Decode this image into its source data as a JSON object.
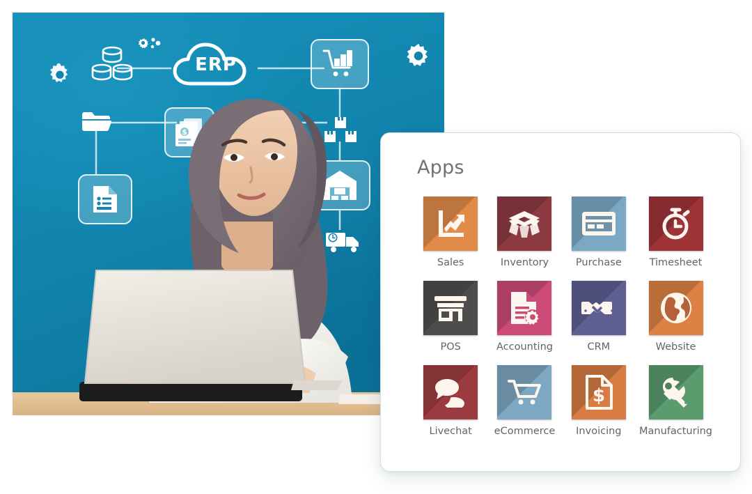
{
  "hero": {
    "alt": "Woman wearing a hijab working on a white laptop in front of an ERP network diagram",
    "background_color": "#1185ae",
    "diagram": {
      "cloud_label": "ERP",
      "nodes": [
        {
          "name": "gear-small",
          "icon": "gear-icon"
        },
        {
          "name": "database-stack",
          "icon": "database-icon"
        },
        {
          "name": "settings-cogs",
          "icon": "cogs-icon"
        },
        {
          "name": "erp-cloud",
          "icon": "cloud-icon",
          "label": "ERP"
        },
        {
          "name": "shopping-cart",
          "icon": "cart-boxes-icon"
        },
        {
          "name": "gear-large",
          "icon": "gear-icon"
        },
        {
          "name": "folder",
          "icon": "folder-icon"
        },
        {
          "name": "invoices",
          "icon": "invoice-stack-icon"
        },
        {
          "name": "boxes",
          "icon": "boxes-icon"
        },
        {
          "name": "report-document",
          "icon": "document-report-icon"
        },
        {
          "name": "warehouse",
          "icon": "warehouse-icon"
        },
        {
          "name": "delivery-truck",
          "icon": "truck-clock-icon"
        }
      ]
    }
  },
  "apps_panel": {
    "title": "Apps",
    "apps": [
      {
        "label": "Sales",
        "icon": "chart-arrow-up-icon",
        "color": "#e08b4a"
      },
      {
        "label": "Inventory",
        "icon": "open-box-icon",
        "color": "#8c3b42"
      },
      {
        "label": "Purchase",
        "icon": "credit-card-icon",
        "color": "#7ba9c4"
      },
      {
        "label": "Timesheet",
        "icon": "stopwatch-icon",
        "color": "#9e3338"
      },
      {
        "label": "POS",
        "icon": "storefront-icon",
        "color": "#4d4d4d"
      },
      {
        "label": "Accounting",
        "icon": "document-gear-icon",
        "color": "#cc4a78"
      },
      {
        "label": "CRM",
        "icon": "handshake-icon",
        "color": "#5d5f93"
      },
      {
        "label": "Website",
        "icon": "globe-icon",
        "color": "#dd8144"
      },
      {
        "label": "Livechat",
        "icon": "speech-bubbles-icon",
        "color": "#9c3b3f"
      },
      {
        "label": "eCommerce",
        "icon": "shopping-cart-icon",
        "color": "#7ea7c2"
      },
      {
        "label": "Invoicing",
        "icon": "invoice-dollar-icon",
        "color": "#d77c42"
      },
      {
        "label": "Manufacturing",
        "icon": "wrench-icon",
        "color": "#5a9c6e"
      }
    ]
  }
}
